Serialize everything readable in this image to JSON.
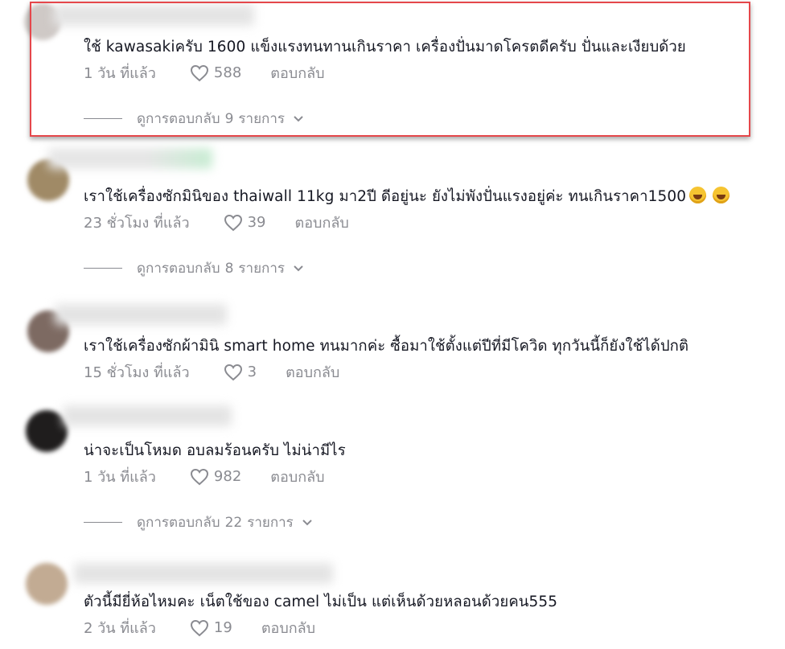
{
  "comments": [
    {
      "text": "ใช้ kawasakiครับ 1600 แข็งแรงทนทานเกินราคา เครื่องปั่นมาดโครตดีครับ ปั่นและเงียบด้วย",
      "time": "1 วัน ที่แล้ว",
      "likes": "588",
      "reply": "ตอบกลับ",
      "replies": {
        "prefix": "ดูการตอบกลับ",
        "count": "9",
        "suffix": "รายการ"
      }
    },
    {
      "text": "เราใช้เครื่องซักมินิของ thaiwall 11kg มา2ปี ดีอยู่นะ ยังไม่พังปั่นแรงอยู่ค่ะ ทนเกินราคา1500",
      "time": "23 ชั่วโมง ที่แล้ว",
      "likes": "39",
      "reply": "ตอบกลับ",
      "replies": {
        "prefix": "ดูการตอบกลับ",
        "count": "8",
        "suffix": "รายการ"
      }
    },
    {
      "text": "เราใช้เครื่องซักผ้ามินิ smart home ทนมากค่ะ ซื้อมาใช้ตั้งแต่ปีที่มีโควิด ทุกวันนี้ก็ยังใช้ได้ปกติ",
      "time": "15 ชั่วโมง ที่แล้ว",
      "likes": "3",
      "reply": "ตอบกลับ"
    },
    {
      "text": "น่าจะเป็นโหมด อบลมร้อนครับ ไม่น่ามีไร",
      "time": "1 วัน ที่แล้ว",
      "likes": "982",
      "reply": "ตอบกลับ",
      "replies": {
        "prefix": "ดูการตอบกลับ",
        "count": "22",
        "suffix": "รายการ"
      }
    },
    {
      "text": "ตัวนี้มียี่ห้อไหมคะ เน็ตใช้ของ camel ไม่เป็น แต่เห็นด้วยหลอนด้วยคน555",
      "time": "2 วัน ที่แล้ว",
      "likes": "19",
      "reply": "ตอบกลับ"
    }
  ],
  "colors": {
    "highlight": "#e5474b",
    "muted": "#8a8b91",
    "text": "#161823"
  },
  "icons": [
    "heart-icon",
    "chevron-down-icon",
    "laughing-emoji-icon"
  ]
}
